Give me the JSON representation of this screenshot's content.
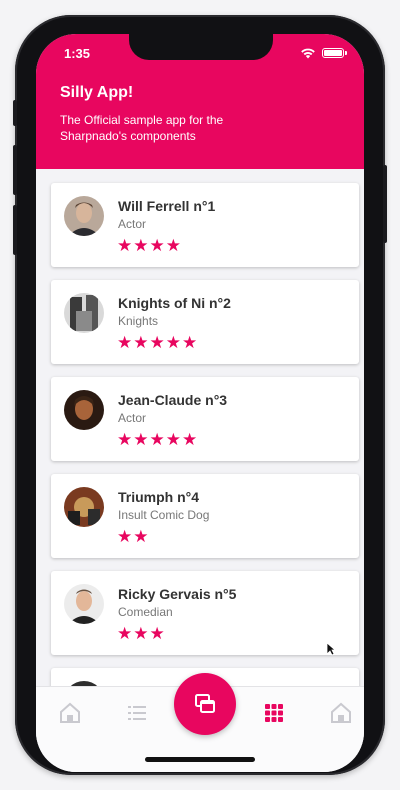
{
  "status_bar": {
    "time": "1:35"
  },
  "header": {
    "title": "Silly App!",
    "subtitle": "The Official sample app for the Sharpnado's components"
  },
  "list": {
    "items": [
      {
        "name": "Will Ferrell n°1",
        "role": "Actor",
        "stars": "★★★★",
        "rating": 4
      },
      {
        "name": "Knights of Ni n°2",
        "role": "Knights",
        "stars": "★★★★★",
        "rating": 5
      },
      {
        "name": "Jean-Claude n°3",
        "role": "Actor",
        "stars": "★★★★★",
        "rating": 5
      },
      {
        "name": "Triumph n°4",
        "role": "Insult Comic Dog",
        "stars": "★★",
        "rating": 2
      },
      {
        "name": "Ricky Gervais n°5",
        "role": "Comedian",
        "stars": "★★★",
        "rating": 3
      }
    ]
  },
  "tabs": [
    {
      "icon": "house-icon",
      "active": false
    },
    {
      "icon": "list-icon",
      "active": false
    },
    {
      "icon": "cards-icon",
      "active": true
    },
    {
      "icon": "grid-icon",
      "active": true
    },
    {
      "icon": "house-icon",
      "active": false
    }
  ],
  "colors": {
    "accent": "#e8065f",
    "inactive_icon": "#c9c9cf"
  }
}
